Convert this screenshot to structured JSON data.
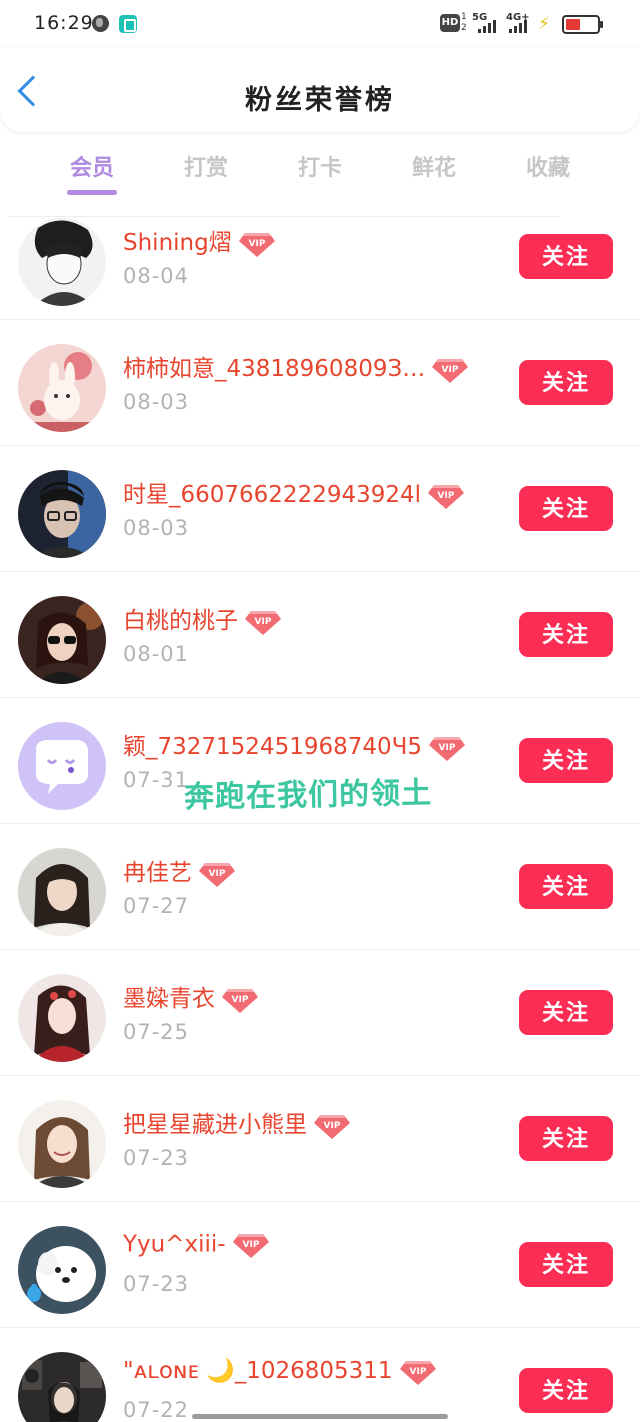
{
  "status_bar": {
    "time": "16:29",
    "hd_badge": "HD",
    "hd_nums": [
      "1",
      "2"
    ],
    "net1": "5G",
    "net2": "4G+",
    "battery_level": 0.45,
    "battery_color": "#e53935"
  },
  "header": {
    "title": "粉丝荣誉榜"
  },
  "tabs": [
    {
      "label": "会员",
      "active": true
    },
    {
      "label": "打赏",
      "active": false
    },
    {
      "label": "打卡",
      "active": false
    },
    {
      "label": "鲜花",
      "active": false
    },
    {
      "label": "收藏",
      "active": false
    }
  ],
  "colors": {
    "accent": "#b08ae0",
    "follow_button": "#fb2d55",
    "nickname": "#e8452f",
    "date": "#b3b3b3",
    "back_arrow": "#2f8de4",
    "watermark": "#3cc7a0"
  },
  "follow_label": "关注",
  "vip_badge_text": "VIP",
  "members": [
    {
      "nickname": "Shining熠",
      "date": "08-04",
      "avatar": "avatar-anime-boy"
    },
    {
      "nickname": "柿柿如意_43818960809З…",
      "date": "08-03",
      "avatar": "avatar-bunny-illustration"
    },
    {
      "nickname": "时星_6607662222943924l",
      "date": "08-03",
      "avatar": "avatar-boy-portrait"
    },
    {
      "nickname": "白桃的桃子",
      "date": "08-01",
      "avatar": "avatar-girl-sunglasses"
    },
    {
      "nickname": "颖_7327152451968740Ч5",
      "date": "07-31",
      "avatar": "avatar-default-chat"
    },
    {
      "nickname": "冉佳艺",
      "date": "07-27",
      "avatar": "avatar-girl-portrait"
    },
    {
      "nickname": "墨媣青衣",
      "date": "07-25",
      "avatar": "avatar-costume-girl"
    },
    {
      "nickname": "把星星藏进小熊里",
      "date": "07-23",
      "avatar": "avatar-girl-smile"
    },
    {
      "nickname": "Yyu^xiii-",
      "date": "07-23",
      "avatar": "avatar-white-dog"
    },
    {
      "nickname": "\"ᴀʟᴏɴᴇ 🌙_1026805311",
      "date": "07-22",
      "avatar": "avatar-girl-room"
    }
  ],
  "watermark": "奔跑在我们的领土"
}
